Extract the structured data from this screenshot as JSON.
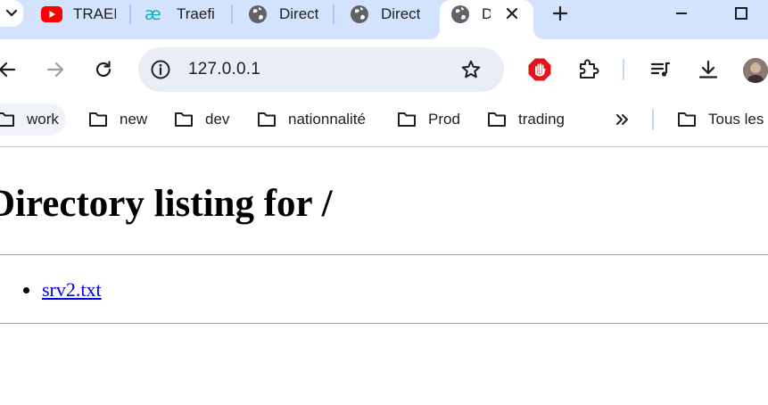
{
  "browser": {
    "tabs": [
      {
        "title": "TRAEF",
        "favicon": "youtube-icon",
        "active": false
      },
      {
        "title": "Traefi",
        "favicon": "traefik-icon",
        "active": false
      },
      {
        "title": "Direct",
        "favicon": "globe-icon",
        "active": false
      },
      {
        "title": "Direct",
        "favicon": "globe-icon",
        "active": false
      },
      {
        "title": "D",
        "favicon": "globe-icon",
        "active": true
      }
    ],
    "address_bar": {
      "url": "127.0.0.1"
    },
    "colors": {
      "tabstrip": "#d3e3fd",
      "omnibox": "#e9eef6",
      "link": "#0000ee",
      "adblock": "#e5141b"
    }
  },
  "bookmarks": [
    {
      "label": "work"
    },
    {
      "label": "new"
    },
    {
      "label": "dev"
    },
    {
      "label": "nationnalité"
    },
    {
      "label": "Prod"
    },
    {
      "label": "trading"
    }
  ],
  "bookmarks_other": {
    "label": "Tous les"
  },
  "page": {
    "heading": "Directory listing for /",
    "files": [
      {
        "name": "srv2.txt"
      }
    ]
  }
}
